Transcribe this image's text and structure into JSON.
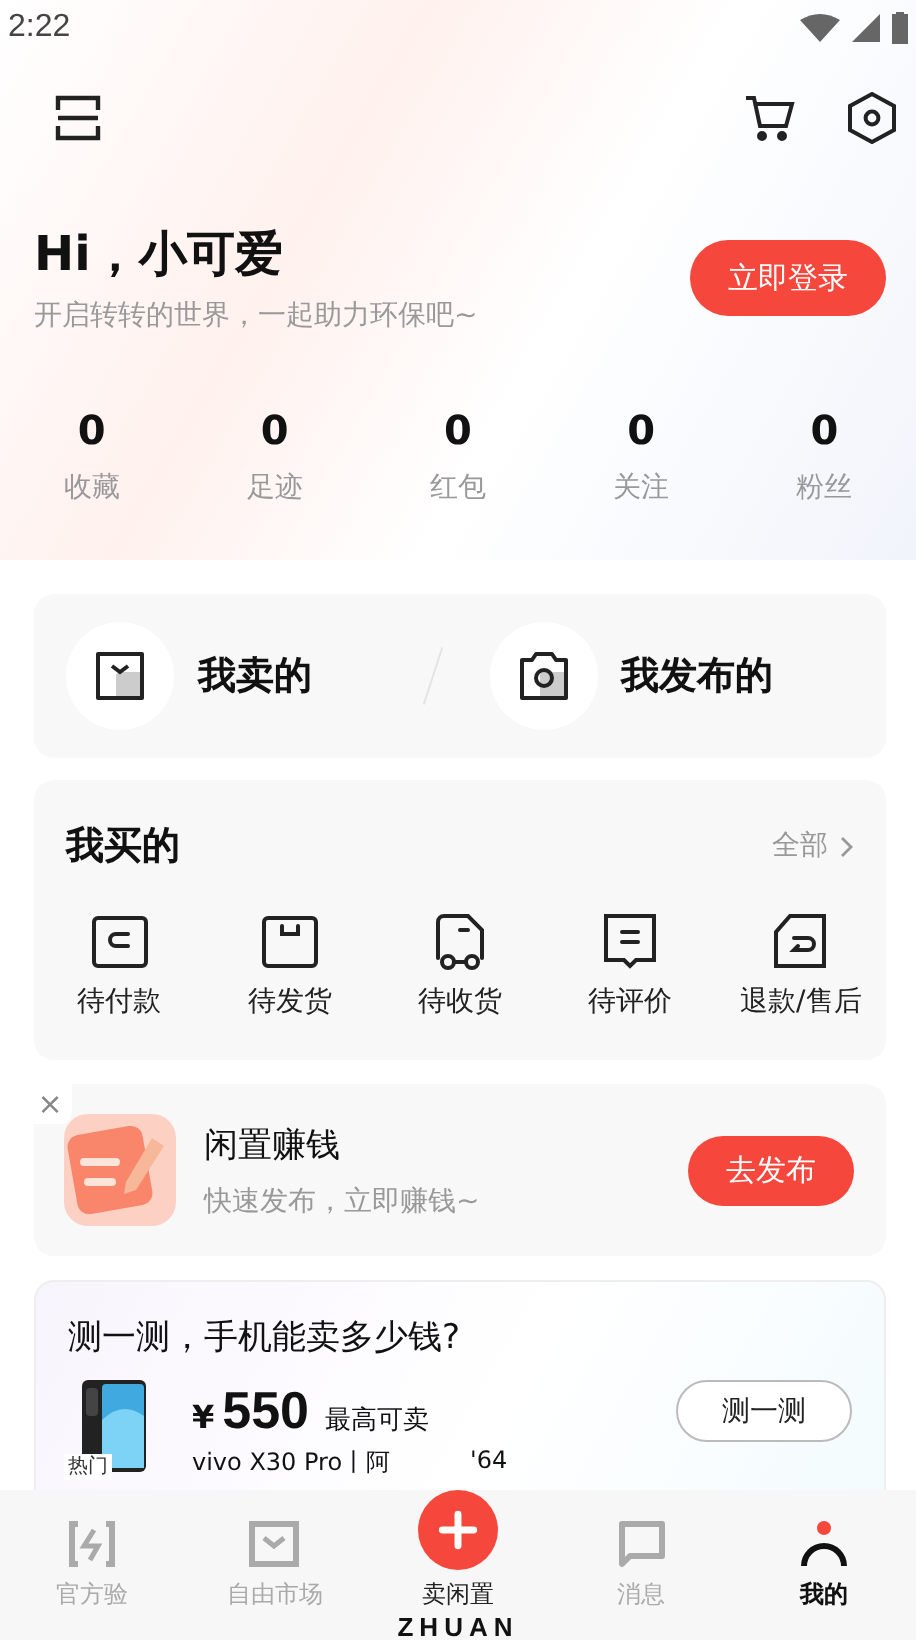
{
  "status_bar": {
    "time": "2:22"
  },
  "greeting": {
    "title": "Hi，小可爱",
    "subtitle": "开启转转的世界，一起助力环保吧~",
    "login_button": "立即登录"
  },
  "stats": [
    {
      "value": "0",
      "label": "收藏"
    },
    {
      "value": "0",
      "label": "足迹"
    },
    {
      "value": "0",
      "label": "红包"
    },
    {
      "value": "0",
      "label": "关注"
    },
    {
      "value": "0",
      "label": "粉丝"
    }
  ],
  "shortcuts": [
    {
      "kind": "bag",
      "label": "我卖的"
    },
    {
      "kind": "camera",
      "label": "我发布的"
    }
  ],
  "orders": {
    "title": "我买的",
    "all_link": "全部",
    "items": [
      {
        "kind": "pay",
        "label": "待付款"
      },
      {
        "kind": "ship",
        "label": "待发货"
      },
      {
        "kind": "receive",
        "label": "待收货"
      },
      {
        "kind": "review",
        "label": "待评价"
      },
      {
        "kind": "refund",
        "label": "退款/售后"
      }
    ]
  },
  "promo": {
    "close": "×",
    "title": "闲置赚钱",
    "subtitle": "快速发布，立即赚钱~",
    "button": "去发布"
  },
  "valuation": {
    "title": "测一测，手机能卖多少钱?",
    "tag": "热门",
    "currency": "¥",
    "price": "550",
    "price_note": "最高可卖",
    "model": "vivo X30 Pro丨阿",
    "model_tail": "'64",
    "button": "测一测"
  },
  "bottom_nav": [
    {
      "kind": "check",
      "label": "官方验",
      "selected": false
    },
    {
      "kind": "market",
      "label": "自由市场",
      "selected": false
    },
    {
      "kind": "sell",
      "label": "卖闲置",
      "selected": false
    },
    {
      "kind": "message",
      "label": "消息",
      "selected": false
    },
    {
      "kind": "me",
      "label": "我的",
      "selected": true
    }
  ],
  "brand": "ZHUAN"
}
